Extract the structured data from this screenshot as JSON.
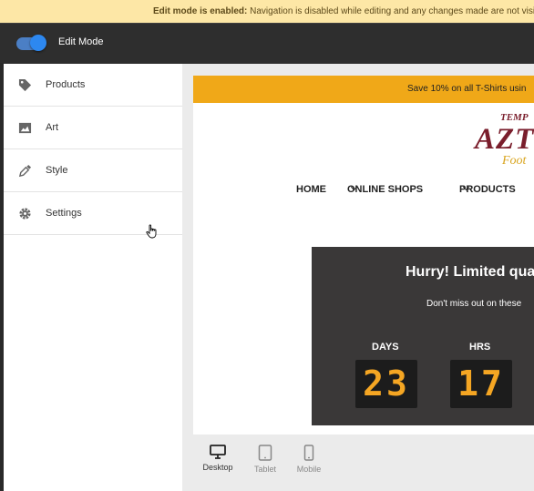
{
  "notice": {
    "bold": "Edit mode is enabled:",
    "text": " Navigation is disabled while editing and any changes made are not visible"
  },
  "topbar": {
    "mode_label": "Edit Mode",
    "toggle_on": true,
    "accent": "#2d88f0"
  },
  "sidebar": {
    "items": [
      {
        "label": "Products",
        "icon": "tag-icon"
      },
      {
        "label": "Art",
        "icon": "image-icon"
      },
      {
        "label": "Style",
        "icon": "eyedropper-icon"
      },
      {
        "label": "Settings",
        "icon": "gear-icon"
      }
    ]
  },
  "preview": {
    "promo": "Save 10% on all T-Shirts usin",
    "promo_color": "#f0a818",
    "logo": {
      "line1": "TEMP",
      "line2": "AZTE",
      "line3": "Foot"
    },
    "nav": [
      {
        "label": "HOME"
      },
      {
        "label": "ONLINE SHOPS"
      },
      {
        "label": "PRODUCTS"
      }
    ],
    "countdown": {
      "title": "Hurry! Limited qua",
      "subtitle": "Don't miss out on these",
      "units": [
        {
          "label": "DAYS",
          "value": "23"
        },
        {
          "label": "HRS",
          "value": "17"
        }
      ],
      "digit_color": "#f5a623"
    }
  },
  "devices": [
    {
      "label": "Desktop",
      "icon": "desktop-icon",
      "active": true
    },
    {
      "label": "Tablet",
      "icon": "tablet-icon",
      "active": false
    },
    {
      "label": "Mobile",
      "icon": "mobile-icon",
      "active": false
    }
  ]
}
